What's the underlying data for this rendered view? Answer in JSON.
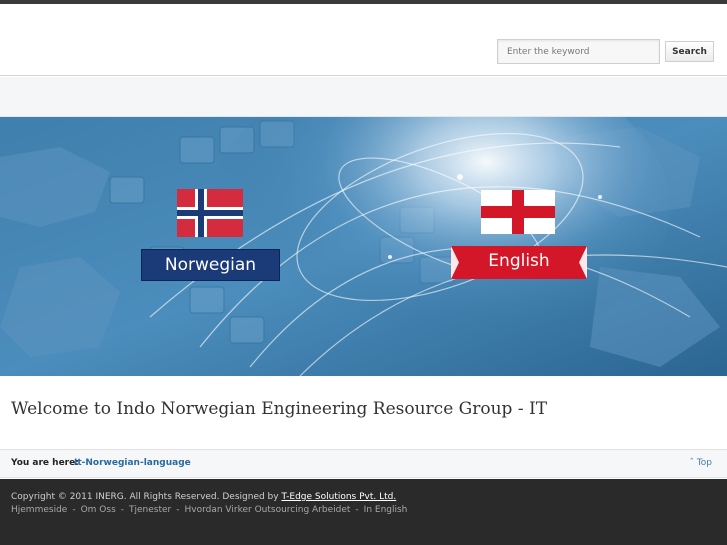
{
  "header": {
    "search": {
      "placeholder": "Enter the keyword",
      "value": ""
    },
    "search_button_label": "Search"
  },
  "banner": {
    "languages": [
      {
        "label": "Norwegian",
        "flag": "norway-flag-icon"
      },
      {
        "label": "English",
        "flag": "england-flag-icon"
      }
    ]
  },
  "main": {
    "title": "Welcome to Indo Norwegian Engineering Resource Group - IT"
  },
  "breadcrumb": {
    "label": "You are here:",
    "current": "It-Norwegian-language",
    "top_link": "Top"
  },
  "footer": {
    "copyright": "Copyright © 2011 INERG. All Rights Reserved. Designed by",
    "designer": "T-Edge Solutions Pvt. Ltd.",
    "nav": [
      "Hjemmeside",
      "Om Oss",
      "Tjenester",
      "Hvordan Virker Outsourcing Arbeidet",
      "In English"
    ],
    "separator": "-"
  },
  "colors": {
    "accent": "#2a6aa0",
    "norway_red": "#d52b3e",
    "norway_blue": "#1a3a78",
    "england_red": "#d31628",
    "footer_bg": "#2a2a2a"
  }
}
